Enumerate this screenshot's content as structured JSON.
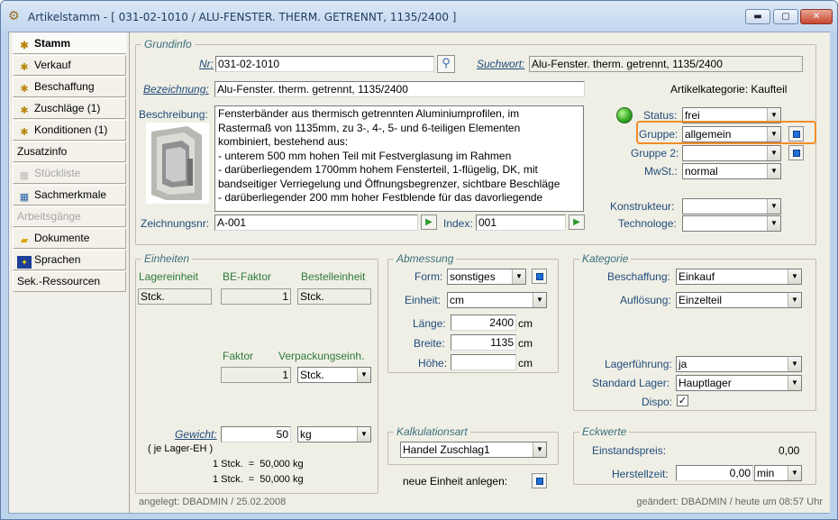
{
  "window": {
    "title": "Artikelstamm - [ 031-02-1010 / ALU-FENSTER. THERM. GETRENNT, 1135/2400 ]",
    "min_label": "▬",
    "max_label": "▢",
    "close_label": "✕"
  },
  "nav": {
    "items": [
      {
        "label": "Stamm",
        "icon": "gear-star-icon",
        "state": "active"
      },
      {
        "label": "Verkauf",
        "icon": "gear-star-icon",
        "state": "normal"
      },
      {
        "label": "Beschaffung",
        "icon": "gear-star-icon",
        "state": "normal"
      },
      {
        "label": "Zuschläge (1)",
        "icon": "gear-star-icon",
        "state": "normal"
      },
      {
        "label": "Konditionen (1)",
        "icon": "gear-star-icon",
        "state": "normal"
      },
      {
        "label": "Zusatzinfo",
        "icon": "",
        "state": "normal"
      },
      {
        "label": "Stückliste",
        "icon": "grid-icon",
        "state": "disabled"
      },
      {
        "label": "Sachmerkmale",
        "icon": "grid-icon",
        "state": "normal"
      },
      {
        "label": "Arbeitsgänge",
        "icon": "",
        "state": "disabled"
      },
      {
        "label": "Dokumente",
        "icon": "folder-icon",
        "state": "normal"
      },
      {
        "label": "Sprachen",
        "icon": "eu-flag-icon",
        "state": "normal"
      },
      {
        "label": "Sek.-Ressourcen",
        "icon": "",
        "state": "normal"
      }
    ]
  },
  "grundinfo": {
    "legend": "Grundinfo",
    "nr_label": "Nr:",
    "nr_value": "031-02-1010",
    "suchwort_label": "Suchwort:",
    "suchwort_value": "Alu-Fenster. therm. getrennt, 1135/2400",
    "bezeichnung_label": "Bezeichnung:",
    "bezeichnung_value": "Alu-Fenster. therm. getrennt, 1135/2400",
    "artikelkategorie": "Artikelkategorie: Kaufteil",
    "beschreibung_label": "Beschreibung:",
    "beschreibung_lines": [
      "Fensterbänder aus thermisch getrennten Aluminiumprofilen, im",
      "Rastermaß von 1135mm, zu 3-, 4-, 5- und 6-teiligen Elementen",
      "kombiniert, bestehend aus:",
      "- unterem 500 mm hohen Teil mit Festverglasung im Rahmen",
      "- darüberliegendem 1700mm hohem Fensterteil, 1-flügelig, DK, mit",
      "bandseitiger Verriegelung und Öffnungsbegrenzer, sichtbare Beschläge",
      "- darüberliegender 200 mm hoher Festblende für das davorliegende"
    ],
    "status_label": "Status:",
    "status_value": "frei",
    "gruppe_label": "Gruppe:",
    "gruppe_value": "allgemein",
    "gruppe2_label": "Gruppe 2:",
    "gruppe2_value": "",
    "mwst_label": "MwSt.:",
    "mwst_value": "normal",
    "konstrukteur_label": "Konstrukteur:",
    "konstrukteur_value": "",
    "technologe_label": "Technologe:",
    "technologe_value": "",
    "zeichnungsnr_label": "Zeichnungsnr:",
    "zeichnungsnr_value": "A-001",
    "index_label": "Index:",
    "index_value": "001"
  },
  "einheiten": {
    "legend": "Einheiten",
    "lagereinheit_label": "Lagereinheit",
    "lagereinheit_value": "Stck.",
    "befaktor_label": "BE-Faktor",
    "befaktor_value": "1",
    "bestelleinheit_label": "Bestelleinheit",
    "bestelleinheit_value": "Stck.",
    "faktor_label": "Faktor",
    "faktor_value": "1",
    "verpackung_label": "Verpackungseinh.",
    "verpackung_value": "Stck.",
    "gewicht_label": "Gewicht:",
    "gewicht_value": "50",
    "gewicht_unit": "kg",
    "je_lager": "( je Lager-EH )",
    "conv1": "1 Stck.  =  50,000 kg",
    "conv2": "1 Stck.  =  50,000 kg"
  },
  "abmessung": {
    "legend": "Abmessung",
    "form_label": "Form:",
    "form_value": "sonstiges",
    "einheit_label": "Einheit:",
    "einheit_value": "cm",
    "laenge_label": "Länge:",
    "laenge_value": "2400",
    "breite_label": "Breite:",
    "breite_value": "1135",
    "hoehe_label": "Höhe:",
    "hoehe_value": "",
    "unit": "cm"
  },
  "kategorie": {
    "legend": "Kategorie",
    "beschaffung_label": "Beschaffung:",
    "beschaffung_value": "Einkauf",
    "aufloesung_label": "Auflösung:",
    "aufloesung_value": "Einzelteil",
    "lagerfuehrung_label": "Lagerführung:",
    "lagerfuehrung_value": "ja",
    "standardlager_label": "Standard Lager:",
    "standardlager_value": "Hauptlager",
    "dispo_label": "Dispo:",
    "dispo_checked": "✓"
  },
  "kalkulation": {
    "legend": "Kalkulationsart",
    "value": "Handel Zuschlag1",
    "neue_einheit": "neue Einheit anlegen:"
  },
  "eckwerte": {
    "legend": "Eckwerte",
    "einstandspreis_label": "Einstandspreis:",
    "einstandspreis_value": "0,00",
    "herstellzeit_label": "Herstellzeit:",
    "herstellzeit_value": "0,00",
    "herstellzeit_unit": "min"
  },
  "footer": {
    "created": "angelegt: DBADMIN / 25.02.2008",
    "changed": "geändert: DBADMIN / heute um 08:57 Uhr"
  },
  "colors": {
    "accent_highlight": "#f28c28",
    "label_blue": "#1f4b7a",
    "legend_teal": "#3a6f7c"
  }
}
